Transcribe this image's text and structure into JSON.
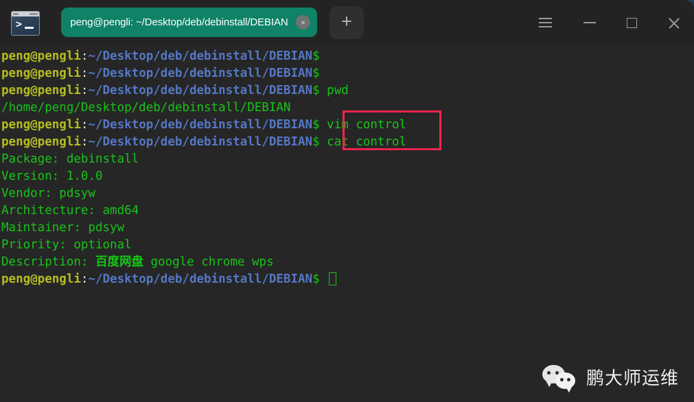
{
  "window": {
    "app_icon": "terminal-icon",
    "prompt_glyph": ">",
    "tab": {
      "title": "peng@pengli: ~/Desktop/deb/debinstall/DEBIAN",
      "close_label": "×",
      "color": "#0f8268"
    },
    "new_tab_label": "+",
    "controls": {
      "menu": "hamburger-menu",
      "minimize": "minimize",
      "maximize": "maximize",
      "close": "close"
    }
  },
  "terminal": {
    "colors": {
      "background": "#262626",
      "user": "#b5bd22",
      "path": "#5577c4",
      "output": "#19c319",
      "separator": "#e8e8e8"
    },
    "prompt": {
      "user_host": "peng@pengli",
      "separator": ":",
      "path": "~/Desktop/deb/debinstall/DEBIAN",
      "dollar": "$"
    },
    "lines": [
      {
        "type": "prompt",
        "command": ""
      },
      {
        "type": "prompt",
        "command": ""
      },
      {
        "type": "prompt",
        "command": "pwd"
      },
      {
        "type": "output",
        "text": "/home/peng/Desktop/deb/debinstall/DEBIAN"
      },
      {
        "type": "prompt",
        "command": "vim control"
      },
      {
        "type": "prompt",
        "command": "cat control"
      },
      {
        "type": "output",
        "text": "Package: debinstall"
      },
      {
        "type": "output",
        "text": "Version: 1.0.0"
      },
      {
        "type": "output",
        "text": "Vendor: pdsyw"
      },
      {
        "type": "output",
        "text": "Architecture: amd64"
      },
      {
        "type": "output",
        "text": "Maintainer: pdsyw"
      },
      {
        "type": "output",
        "text": "Priority: optional"
      },
      {
        "type": "output_mixed",
        "prefix": "Description: ",
        "cjk": "百度网盘",
        "suffix": " google chrome wps"
      },
      {
        "type": "prompt_cursor",
        "command": ""
      }
    ]
  },
  "annotation": {
    "color": "#f2254e",
    "highlighted_commands": [
      "vim control",
      "cat control"
    ]
  },
  "watermark": {
    "icon": "wechat-icon",
    "text": "鹏大师运维"
  }
}
